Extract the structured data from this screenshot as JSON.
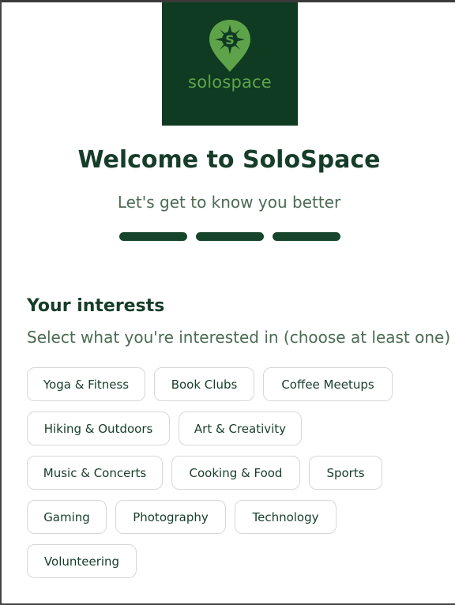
{
  "brand": {
    "logo_text": "solospace",
    "logo_letter": "S"
  },
  "header": {
    "title": "Welcome to SoloSpace",
    "subtitle": "Let's get to know you better",
    "progress_steps_completed": 3,
    "progress_steps_total": 3
  },
  "interests": {
    "title": "Your interests",
    "subtitle": "Select what you're interested in (choose at least one)",
    "options": [
      "Yoga & Fitness",
      "Book Clubs",
      "Coffee Meetups",
      "Hiking & Outdoors",
      "Art & Creativity",
      "Music & Concerts",
      "Cooking & Food",
      "Sports",
      "Gaming",
      "Photography",
      "Technology",
      "Volunteering"
    ]
  },
  "colors": {
    "brand_dark": "#0f3b22",
    "brand_light": "#5ea34a",
    "text_primary": "#163d29",
    "text_secondary": "#4b6b53"
  }
}
